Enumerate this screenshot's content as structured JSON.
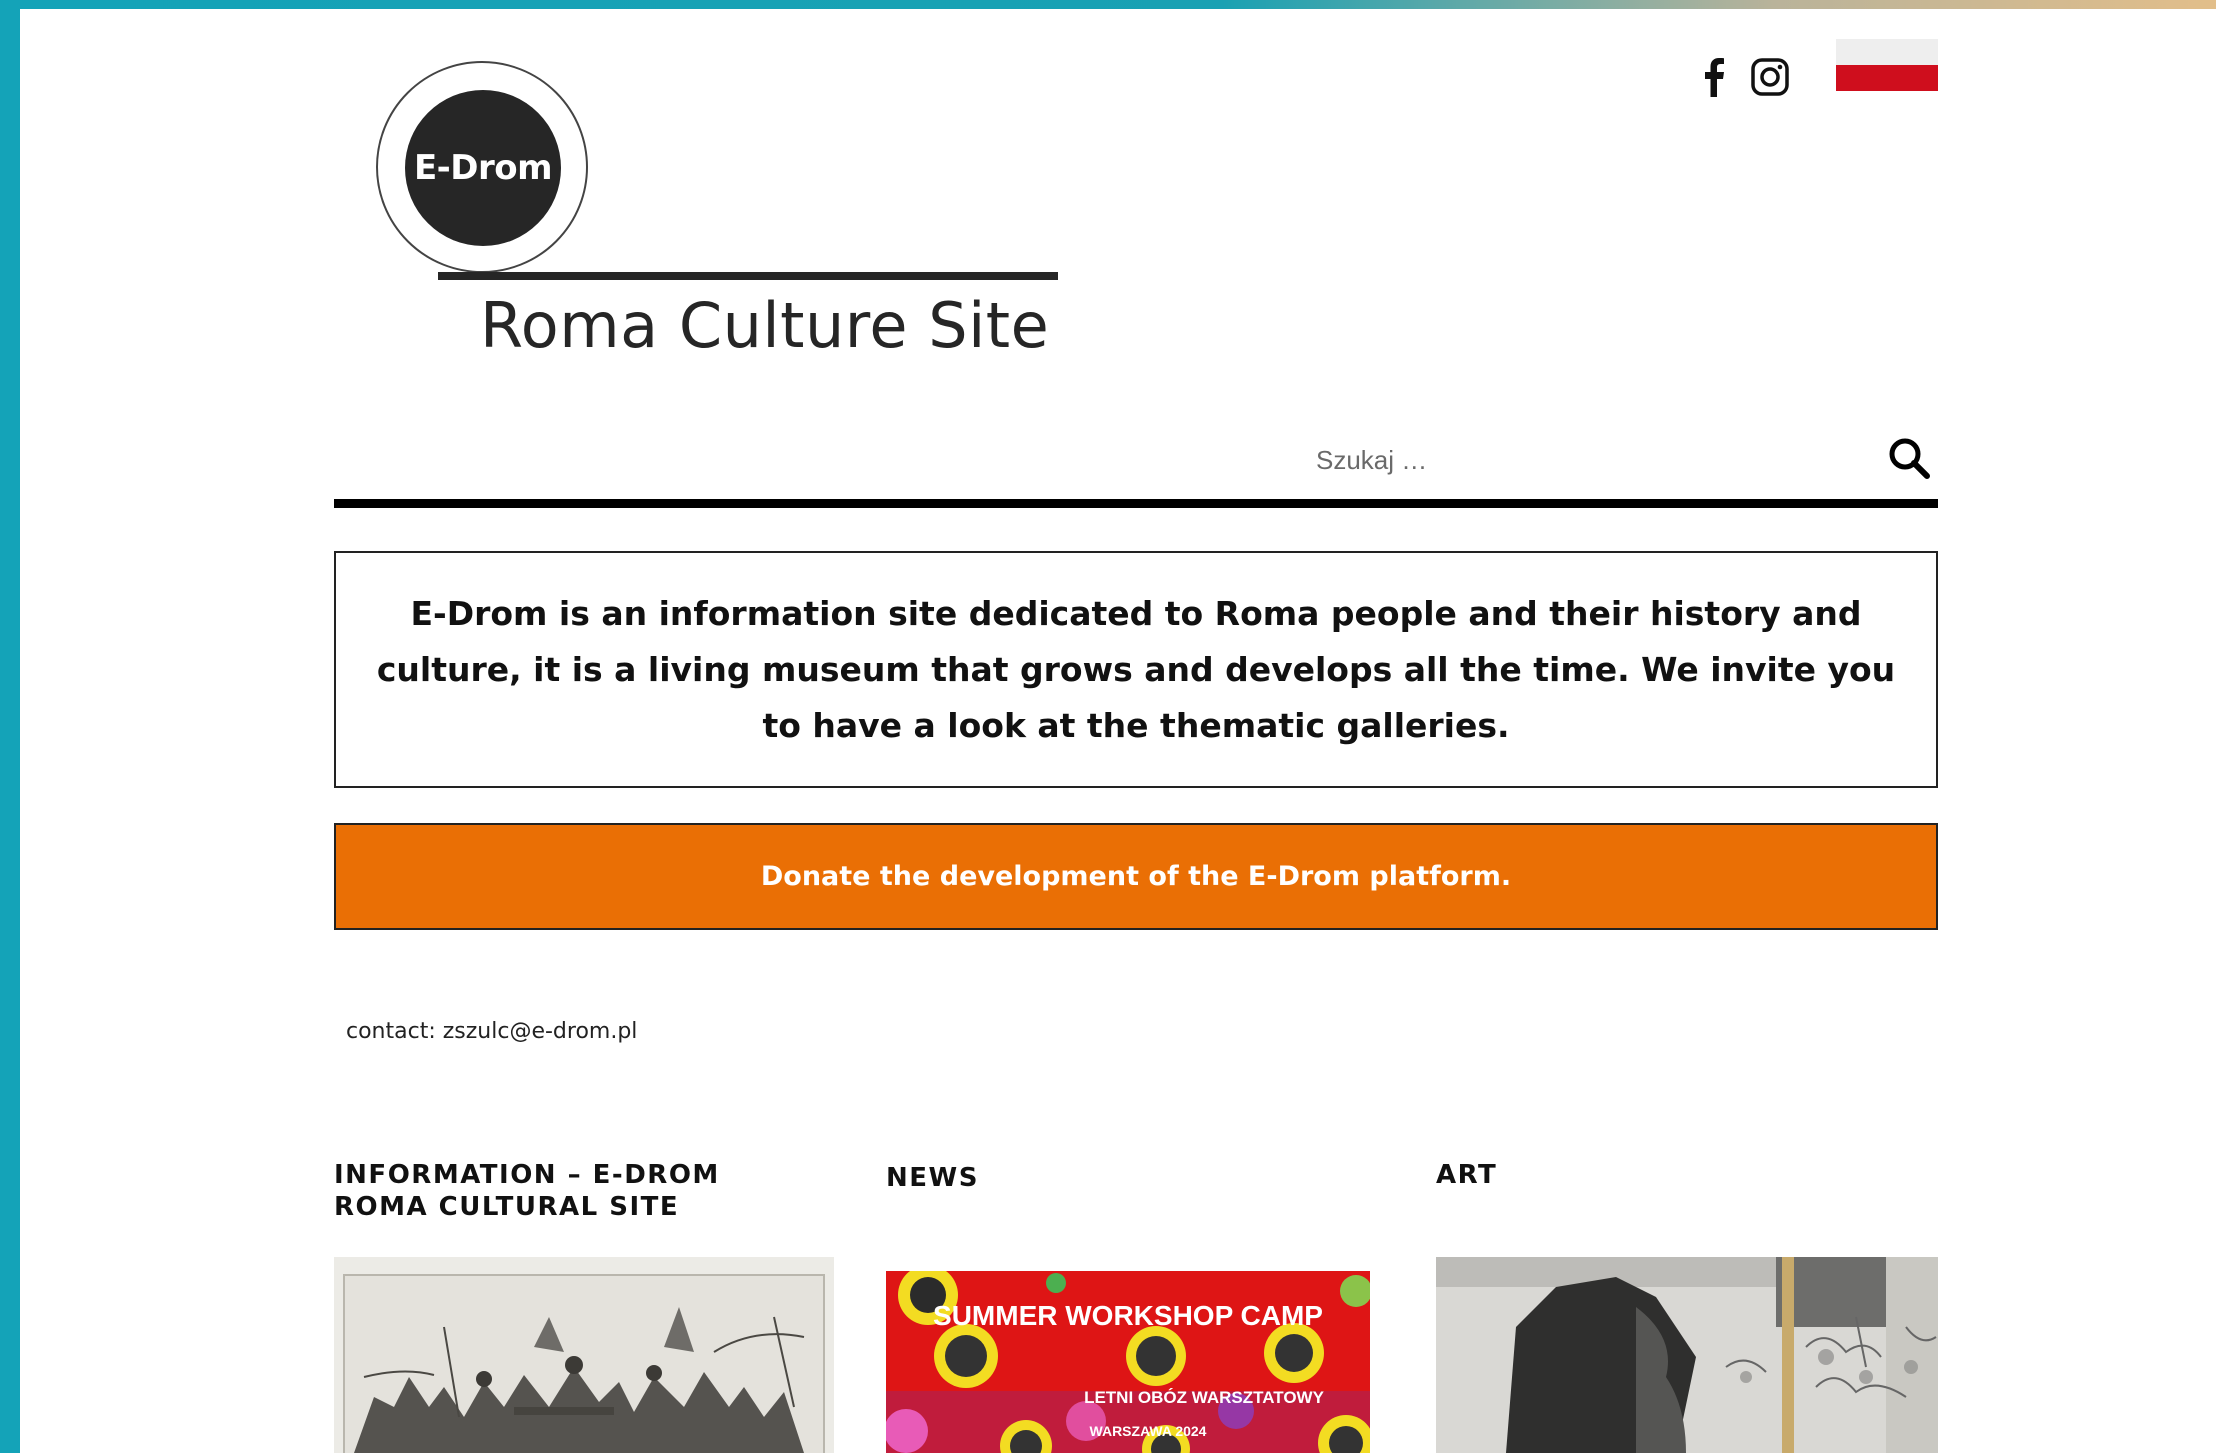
{
  "logo": {
    "mark": "E-Drom",
    "subtitle": "Roma Culture Site"
  },
  "social": {
    "facebook_icon": "facebook-icon",
    "instagram_icon": "instagram-icon"
  },
  "language_flag": {
    "icon": "poland-flag-icon",
    "colors": {
      "white": "#eeeeee",
      "red": "#cf0e1d"
    }
  },
  "search": {
    "placeholder": "Szukaj …",
    "icon": "search-icon"
  },
  "intro": {
    "text": "E-Drom is an information site dedicated to Roma people and their history and culture, it is a living museum that grows and develops all the time. We invite you to have a look at the thematic galleries."
  },
  "donate": {
    "label": "Donate the development of the E-Drom platform.",
    "color": "#ea6f05"
  },
  "contact": {
    "text": "contact: zszulc@e-drom.pl"
  },
  "sections": [
    {
      "title": "INFORMATION – E-DROM ROMA CULTURAL SITE",
      "image_icon": "historical-engraving-image"
    },
    {
      "title": "NEWS",
      "image_caption_main": "SUMMER WORKSHOP CAMP",
      "image_caption_sub": "LETNI OBÓZ WARSZTATOWY",
      "image_caption_sub2": "WARSZAWA 2024"
    },
    {
      "title": "ART",
      "image_icon": "art-installation-image"
    }
  ]
}
